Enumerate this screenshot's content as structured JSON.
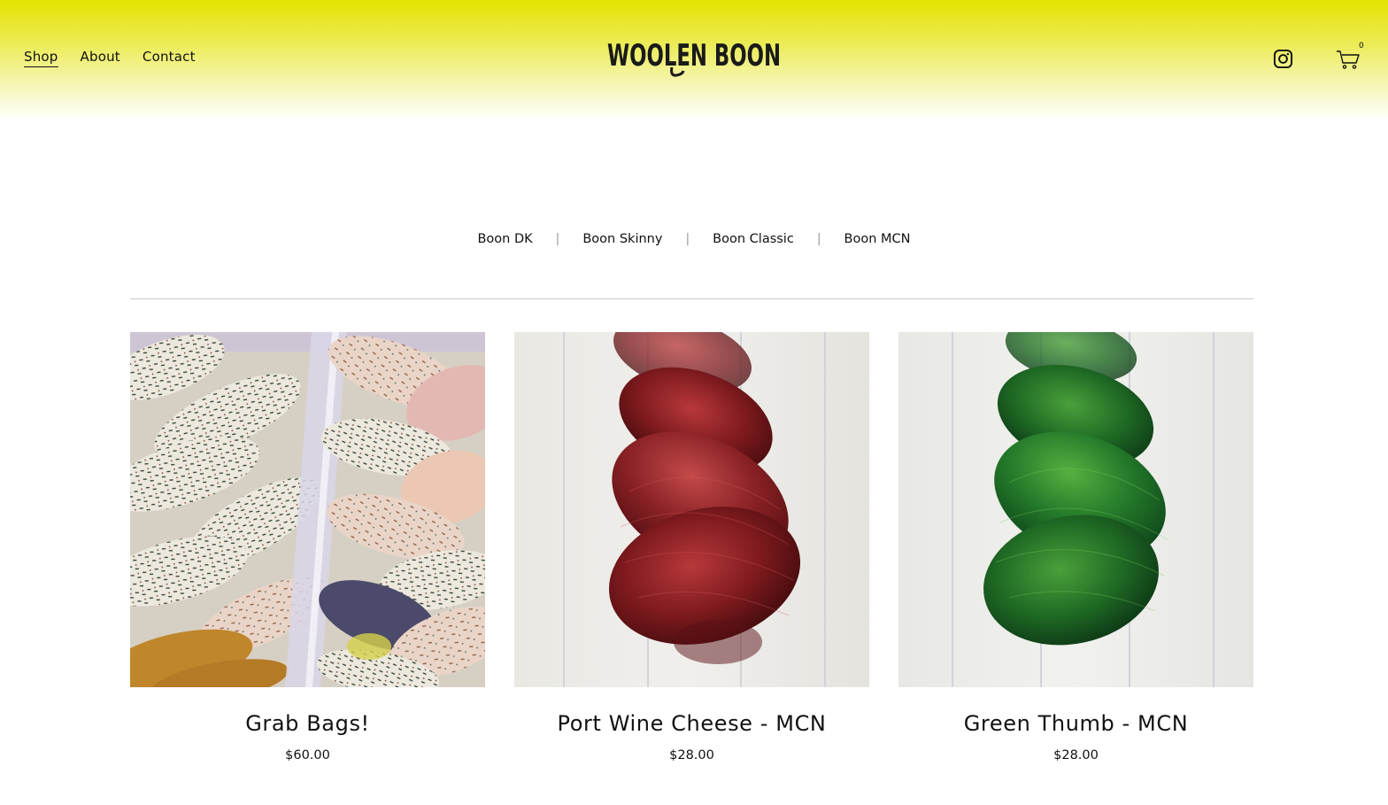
{
  "header": {
    "nav": [
      {
        "label": "Shop",
        "active": true
      },
      {
        "label": "About",
        "active": false
      },
      {
        "label": "Contact",
        "active": false
      }
    ],
    "logo_text": "WOOLEN BOON",
    "cart_count": "0",
    "icons": [
      "instagram-icon",
      "cart-icon"
    ]
  },
  "categories": [
    "Boon DK",
    "Boon Skinny",
    "Boon Classic",
    "Boon MCN"
  ],
  "products": [
    {
      "title": "Grab Bags!",
      "price": "$60.00"
    },
    {
      "title": "Port Wine Cheese - MCN",
      "price": "$28.00"
    },
    {
      "title": "Green Thumb - MCN",
      "price": "$28.00"
    }
  ],
  "colors": {
    "header_top": "#e4e200",
    "text": "#111111",
    "divider": "#c9c9c9"
  }
}
